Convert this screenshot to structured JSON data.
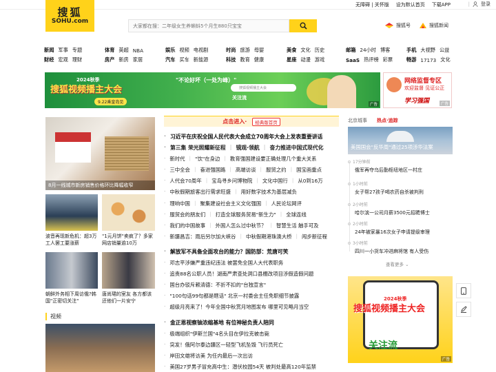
{
  "topbar": {
    "links": [
      "无障碍 | 关怀版",
      "设为默认首页",
      "下载APP"
    ],
    "login": "登录"
  },
  "logo": {
    "cn": "搜狐",
    "en": "SOHU.com"
  },
  "search": {
    "placeholder": "大家都在搜：二年级女生养蝌蚪5个月生880只宝宝"
  },
  "header_links": [
    "搜狐号",
    "搜狐新闻"
  ],
  "nav": [
    {
      "rows": [
        [
          "新闻",
          "军事",
          "专题"
        ],
        [
          "财经",
          "宏观",
          "理财"
        ]
      ]
    },
    {
      "rows": [
        [
          "体育",
          "英超",
          "NBA"
        ],
        [
          "房产",
          "新房",
          "家居"
        ]
      ]
    },
    {
      "rows": [
        [
          "娱乐",
          "视频",
          "电视剧"
        ],
        [
          "汽车",
          "买车",
          "新能源"
        ]
      ]
    },
    {
      "rows": [
        [
          "时尚",
          "旅游",
          "母婴"
        ],
        [
          "科技",
          "教育",
          "健康"
        ]
      ]
    },
    {
      "rows": [
        [
          "美食",
          "文化",
          "历史"
        ],
        [
          "星座",
          "动漫",
          "游戏"
        ]
      ]
    },
    {
      "rows": [
        [
          "邮箱",
          "24小时",
          "博客"
        ],
        [
          "SaaS",
          "热评榜",
          "彩票"
        ]
      ]
    },
    {
      "rows": [
        [
          "手机",
          "大视野",
          "公益"
        ],
        [
          "畅游",
          "17173",
          "文化"
        ]
      ]
    }
  ],
  "banner": {
    "title": "搜狐视频播主大会",
    "season": "2024秋季",
    "date": "9.22乘皇岛见",
    "slogan": "\"不论好坏（一处为峰）\"",
    "follow": "关注流",
    "search_hint": "搜狐视频播主大会",
    "ad": "广告"
  },
  "banner_right": {
    "line1": "网络监督专区",
    "line2": "欢迎监督 见证公正",
    "line3": "学习强国",
    "ad": "广告"
  },
  "left": {
    "lead_caption": "8月一线城市新房销售价格环比降幅收窄",
    "items": [
      {
        "caption": "波音再现新危机：超3万工人罢工要涨薪"
      },
      {
        "caption": "\"1元月饼\"卖疯了？多家网店销量逾10万"
      },
      {
        "caption": "朝鲜外务相下周访俄?韩国\"正密切关注\""
      },
      {
        "caption": "唐尚珺的室友 各方都该还他们一片安宁"
      }
    ],
    "video_section": "视频"
  },
  "mid": {
    "head_left": "点击进入·",
    "head_right": "经典版首页",
    "headline": "习近平在庆祝全国人民代表大会成立70周年大会上发表重要讲话",
    "lines": [
      [
        "第三集 荣光照耀新征程",
        "镜观·领航",
        "奋力推进中国式现代化"
      ],
      [
        "新时代",
        "\"饮\"在身边",
        "教育强国建设要正确处理几个重大关系"
      ],
      [
        "三中全会",
        "奋进强国路",
        "高端访谈",
        "服贸之约",
        "国宝画重点"
      ],
      [
        "人代会70周年",
        "宝岛寻乡问博物院",
        "文化中国行",
        "从0到16万"
      ],
      [
        "中秋假期旅客出行需求旺盛",
        "用好数字技术为基层减负"
      ],
      [
        "理响中国",
        "聚集建设社会主义文化强国",
        "人民论坛网评"
      ],
      [
        "服贸会的朋友们",
        "打造全球服务贸易\"新生力\"",
        "全球连线"
      ],
      [
        "我们的中国故事",
        "外国人怎么过中秋节？",
        "智慧生活 触手可及"
      ],
      [
        "新疆昌吉：雨后另尔加大峡谷",
        "中秋假期港珠澳大桥",
        "闯步新征程"
      ]
    ],
    "news2": [
      "解放军不具备全面攻台的能力？国防部：荒唐可笑",
      "邓志平涉嫌严重违纪违法 被罢免全国人大代表职务",
      "追责88名公职人员！湖南严肃查处洞口县棚改项目涉假造假问题",
      "国台办驳斥赖清德：不折不扣的\"台独宣言\"",
      "\"100句话99句都是瞎话\" 北京一村委会主任免职细节披露",
      "超级月亮来了！今年全国中秋赏月地图发布 哪里可见略月当空"
    ],
    "news3": [
      "金正恩视察铀浓缩基地 有位神秘负责人陪同",
      "极端组织\"伊斯兰国\"4名头目在伊拉克被击毙",
      "突发！俄阿尔泰边疆区一轻型飞机坠毁 飞行员死亡",
      "岸田文雄将访美 为任内最后一次出访",
      "美国27岁男子冒充高中生：潜伏校园54天 被判处最高120年监禁"
    ]
  },
  "right": {
    "tab1": "北京城事",
    "tab2": "热点·追踪",
    "photo_caption": "美国国会\"反华周\"通过25项涉华法案",
    "timeline": [
      {
        "time": "17分钟前",
        "text": "俄军再夺乌后勤枢纽地区一村庄"
      },
      {
        "time": "1小时前",
        "text": "女子帮27孩子喝农药自杀被判刑"
      },
      {
        "time": "2小时前",
        "text": "哈尔滨一公司月薪3500元招聘博士"
      },
      {
        "time": "2小时前",
        "text": "24年被家暴16次女子申请提级审理"
      },
      {
        "time": "3小时前",
        "text": "四川一小货车冲进麻将馆 有人受伤"
      }
    ],
    "more": "查看更多",
    "ad": {
      "title": "搜狐视频播主大会",
      "season": "2024秋季",
      "slogan": "关注流",
      "ad": "广告"
    }
  },
  "colors": {
    "brand": "#ffd21a",
    "accent": "#d22222"
  }
}
